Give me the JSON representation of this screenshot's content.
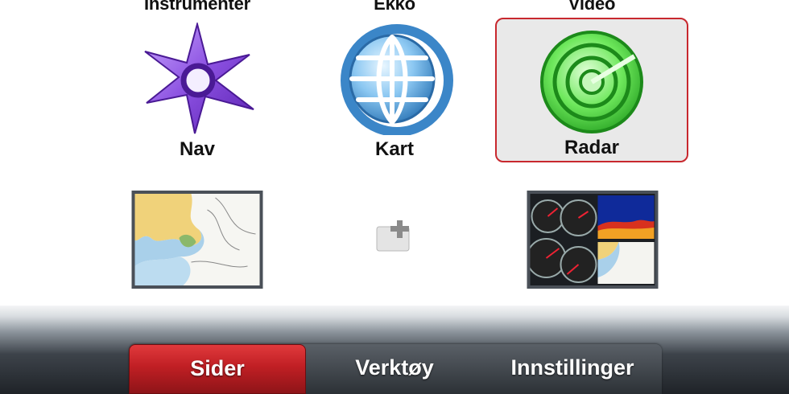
{
  "top_row": {
    "labels": [
      "Instrumenter",
      "Ekko",
      "Video"
    ]
  },
  "apps": [
    {
      "label": "Nav",
      "icon": "nav-compass-icon",
      "color": "#8a4fe0",
      "selected": false
    },
    {
      "label": "Kart",
      "icon": "chart-globe-icon",
      "color": "#4a9ad8",
      "selected": false
    },
    {
      "label": "Radar",
      "icon": "radar-icon",
      "color": "#3ed43a",
      "selected": true
    }
  ],
  "pages": [
    {
      "icon": "chart-map-thumbnail"
    },
    {
      "icon": "add-page-icon"
    },
    {
      "icon": "multi-panel-thumbnail"
    }
  ],
  "tabs": [
    {
      "label": "Sider",
      "active": true
    },
    {
      "label": "Verktøy",
      "active": false
    },
    {
      "label": "Innstillinger",
      "active": false
    }
  ],
  "colors": {
    "selection_border": "#c8282e",
    "active_tab": "#c01f24"
  }
}
